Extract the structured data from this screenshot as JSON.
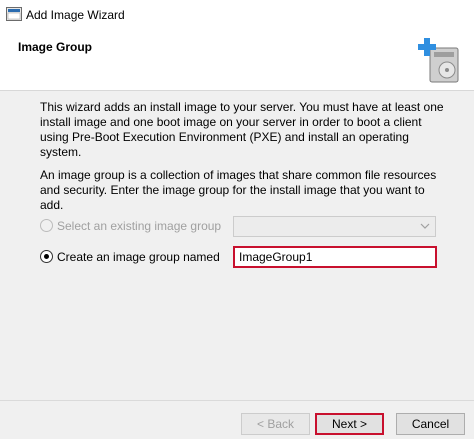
{
  "window": {
    "title": "Add Image Wizard",
    "title_icon": "wizard-app-icon"
  },
  "header": {
    "title": "Image Group",
    "icon": "add-image-icon"
  },
  "body": {
    "paragraph1": "This wizard adds an install image to your server. You must have at least one install image and one boot image on your server in order to boot a client using Pre-Boot Execution Environment (PXE) and install an operating system.",
    "paragraph2": "An image group is a collection of images that share common file resources and security. Enter the image group for the install image that you want to add."
  },
  "options": {
    "existing_label": "Select an existing image group",
    "existing_selected_value": "",
    "new_label": "Create an image group named",
    "new_value": "ImageGroup1"
  },
  "buttons": {
    "back": "< Back",
    "next": "Next >",
    "cancel": "Cancel"
  },
  "colors": {
    "highlight": "#c8102e",
    "background": "#f0f0f0"
  }
}
